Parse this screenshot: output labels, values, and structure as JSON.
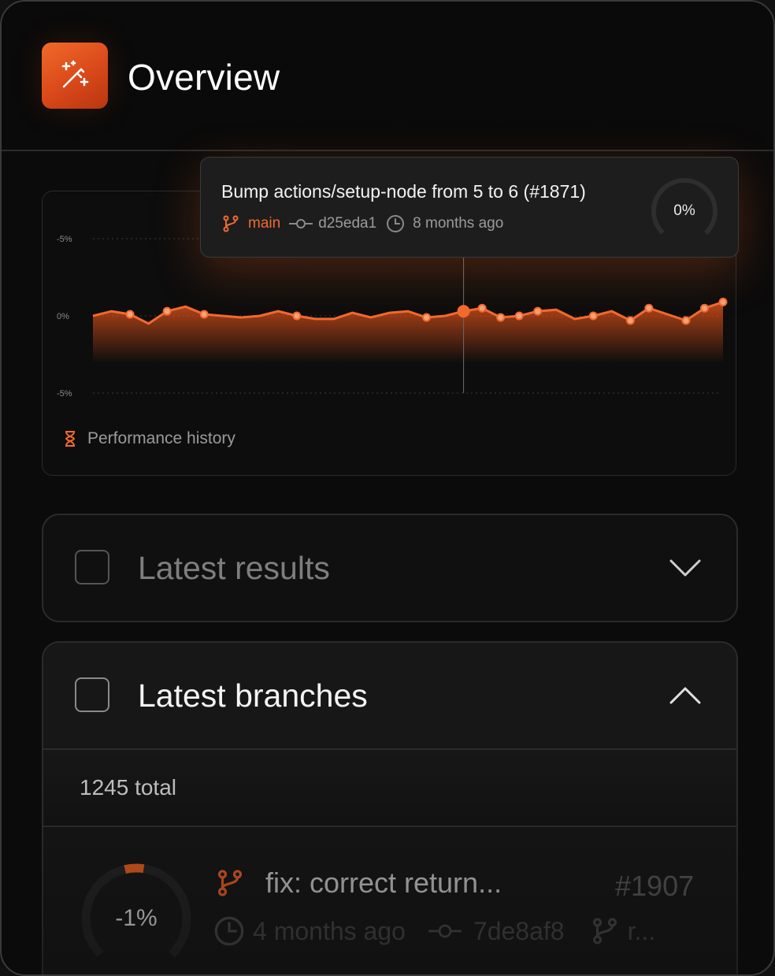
{
  "header": {
    "title": "Overview",
    "logo_icon": "magic-wand-icon",
    "accent": "#e9561d"
  },
  "chart": {
    "footer_label": "Performance history",
    "footer_icon": "hourglass-icon",
    "line_color": "#f26a2e"
  },
  "chart_data": {
    "type": "area",
    "title": "",
    "ylabel": "",
    "y_tick_labels": [
      "-5%",
      "0%",
      "-5%"
    ],
    "ylim": [
      -5,
      5
    ],
    "grid": true,
    "points": [
      0.0,
      0.3,
      0.1,
      -0.5,
      0.3,
      0.6,
      0.1,
      0.0,
      -0.1,
      0.0,
      0.3,
      0.0,
      -0.2,
      -0.2,
      0.2,
      -0.1,
      0.2,
      0.3,
      -0.1,
      0.0,
      0.3,
      0.5,
      -0.1,
      0.0,
      0.3,
      0.4,
      -0.2,
      0.0,
      0.3,
      -0.3,
      0.5,
      0.1,
      -0.3,
      0.5,
      0.9
    ],
    "markers": [
      2,
      4,
      6,
      11,
      18,
      20,
      21,
      22,
      23,
      24,
      27,
      29,
      30,
      32,
      33,
      34
    ],
    "highlight_index": 20
  },
  "tooltip": {
    "title": "Bump actions/setup-node from 5 to 6 (#1871)",
    "branch": "main",
    "commit": "d25eda1",
    "time": "8 months ago",
    "change": "0%",
    "change_fraction": 0.0
  },
  "latest_results": {
    "title": "Latest results",
    "expanded": false
  },
  "latest_branches": {
    "title": "Latest branches",
    "expanded": true,
    "total": "1245 total",
    "rows": [
      {
        "change": "-1%",
        "change_fraction": -0.01,
        "title": "fix: correct return...",
        "number": "#1907",
        "time": "4 months ago",
        "commit": "7de8af8",
        "branch": "r..."
      }
    ]
  }
}
